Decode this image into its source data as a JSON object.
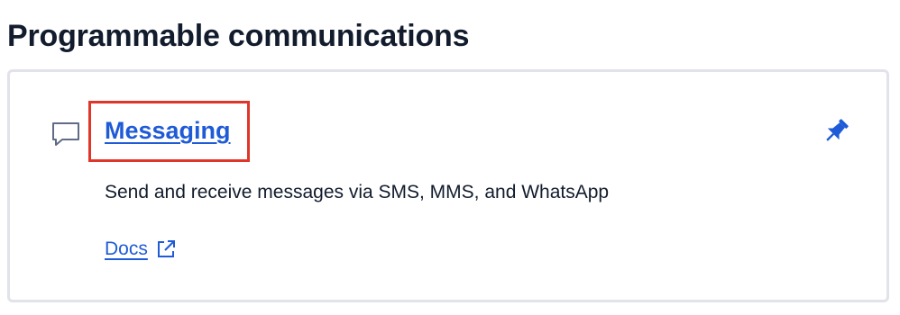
{
  "section": {
    "title": "Programmable communications"
  },
  "card": {
    "icon": "chat-bubble-icon",
    "title": "Messaging",
    "pin_icon": "pin-icon",
    "description": "Send and receive messages via SMS, MMS, and WhatsApp",
    "docs_label": "Docs",
    "docs_icon": "external-link-icon"
  },
  "colors": {
    "link": "#1f5bd6",
    "highlight": "#e0362a",
    "text": "#121c2d",
    "border": "#e1e3ea"
  }
}
